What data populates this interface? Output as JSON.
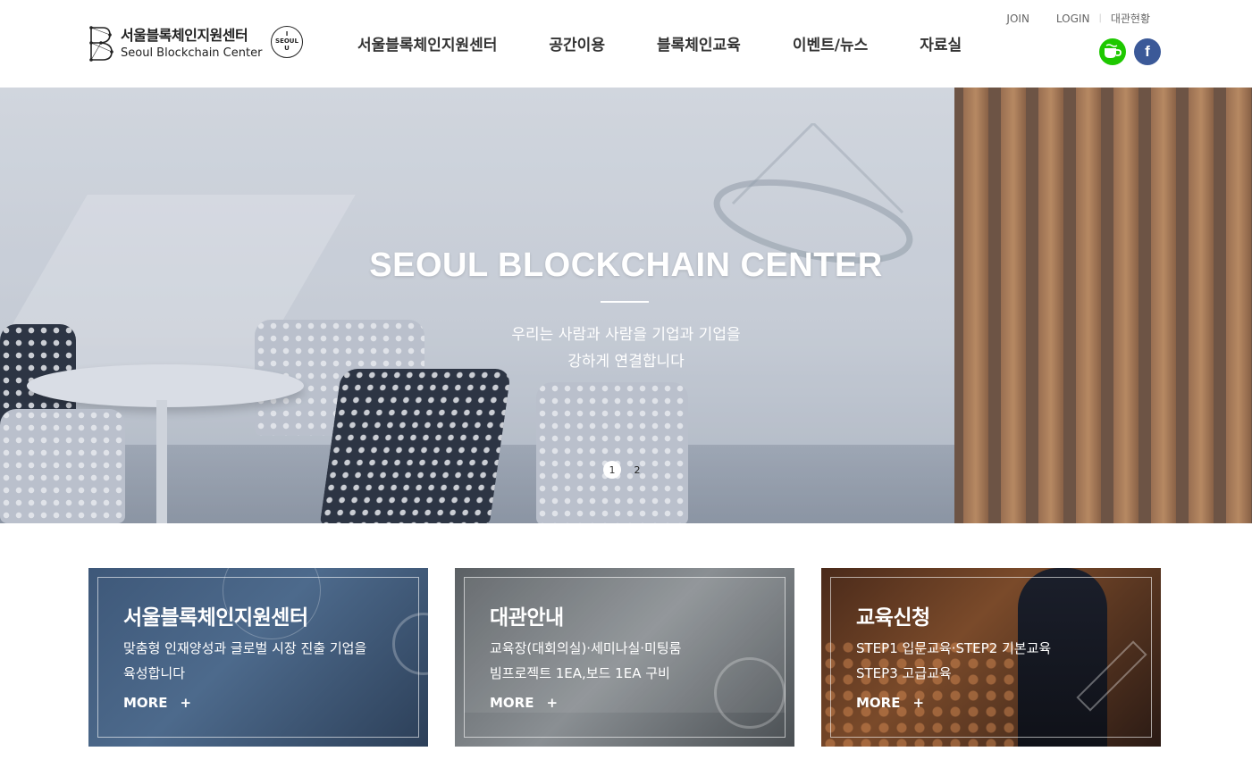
{
  "header": {
    "logo_title_ko": "서울블록체인지원센터",
    "logo_title_en": "Seoul Blockchain Center",
    "seoul_badge": [
      "I",
      "SEOUL",
      "U"
    ],
    "util": {
      "join": "JOIN",
      "login": "LOGIN",
      "separator": "|",
      "rental_status": "대관현황"
    },
    "nav": [
      {
        "label": "서울블록체인지원센터"
      },
      {
        "label": "공간이용"
      },
      {
        "label": "블록체인교육"
      },
      {
        "label": "이벤트/뉴스"
      },
      {
        "label": "자료실"
      }
    ],
    "sns": {
      "cafe_icon": "cafe-cup-icon",
      "facebook_label": "f",
      "cafe_color": "#1ec800",
      "facebook_color": "#3b5998"
    }
  },
  "hero": {
    "title": "SEOUL BLOCKCHAIN CENTER",
    "subtitle_line1": "우리는 사람과 사람을 기업과 기업을",
    "subtitle_line2": "강하게 연결합니다",
    "pager": [
      "1",
      "2"
    ],
    "active_slide": 1
  },
  "cards": [
    {
      "title": "서울블록체인지원센터",
      "desc_line1": "맞춤형 인재양성과 글로벌 시장 진출 기업을",
      "desc_line2": "육성합니다",
      "more": "MORE",
      "plus": "+"
    },
    {
      "title": "대관안내",
      "desc_line1": "교육장(대회의실)·세미나실·미팅룸",
      "desc_line2": "빔프로젝트 1EA,보드 1EA 구비",
      "more": "MORE",
      "plus": "+"
    },
    {
      "title": "교육신청",
      "desc_line1": "STEP1 입문교육·STEP2 기본교육",
      "desc_line2": "STEP3 고급교육",
      "more": "MORE",
      "plus": "+"
    }
  ]
}
